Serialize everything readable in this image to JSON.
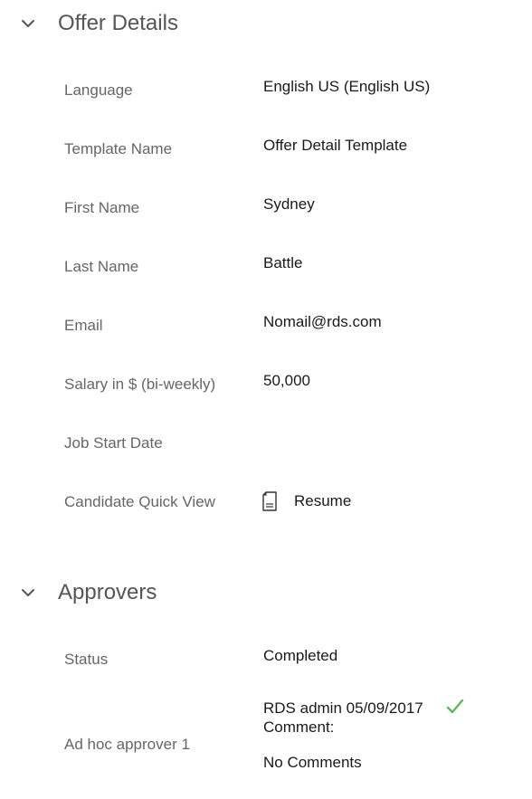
{
  "offer_details": {
    "title": "Offer Details",
    "fields": {
      "language": {
        "label": "Language",
        "value": "English US (English US)"
      },
      "template_name": {
        "label": "Template Name",
        "value": "Offer Detail Template"
      },
      "first_name": {
        "label": "First Name",
        "value": "Sydney"
      },
      "last_name": {
        "label": "Last Name",
        "value": "Battle"
      },
      "email": {
        "label": "Email",
        "value": "Nomail@rds.com"
      },
      "salary": {
        "label": "Salary in $ (bi-weekly)",
        "value": "50,000"
      },
      "job_start_date": {
        "label": "Job Start Date",
        "value": ""
      },
      "candidate_quick_view": {
        "label": "Candidate Quick View",
        "link_label": "Resume",
        "icon": "document-icon"
      }
    }
  },
  "approvers": {
    "title": "Approvers",
    "status": {
      "label": "Status",
      "value": "Completed"
    },
    "approver_1": {
      "label": "Ad hoc approver 1",
      "name_date": "RDS admin 05/09/2017",
      "comment_label": "Comment:",
      "comment": "No Comments",
      "status_icon": "checkmark-icon"
    }
  },
  "colors": {
    "section_title": "#555555",
    "label": "#666666",
    "value": "#1a1a1a",
    "approved_check": "#5cb85c"
  }
}
